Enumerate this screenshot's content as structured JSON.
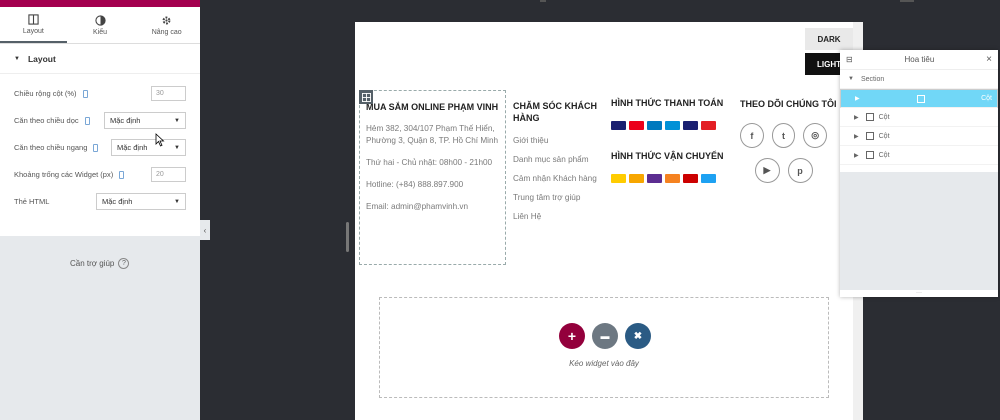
{
  "panel": {
    "tabs": [
      {
        "label": "Layout",
        "icon": "layout-icon"
      },
      {
        "label": "Kiểu",
        "icon": "style-icon"
      },
      {
        "label": "Nâng cao",
        "icon": "gear-icon"
      }
    ],
    "section_title": "Layout",
    "controls": {
      "column_width": {
        "label": "Chiều rộng cột (%)",
        "value": "30"
      },
      "vertical_align": {
        "label": "Căn theo chiều dọc",
        "value": "Mặc định"
      },
      "horizontal_align": {
        "label": "Căn theo chiều ngang",
        "value": "Mặc định"
      },
      "widget_spacing": {
        "label": "Khoảng trống các Widget (px)",
        "value": "20"
      },
      "html_tag": {
        "label": "Thẻ HTML",
        "value": "Mặc định"
      }
    },
    "help_label": "Cần trợ giúp",
    "accent_color": "#a4004f"
  },
  "canvas": {
    "mode_dark": "DARK",
    "mode_light": "LIGHT",
    "col1": {
      "title": "MUA SẮM ONLINE PHẠM VINH",
      "address": "Hẻm 382, 304/107 Phạm Thế Hiển, Phường 3, Quận 8, TP. Hồ Chí Minh",
      "hours": "Thứ hai - Chủ nhật: 08h00 - 21h00",
      "hotline": "Hotline: (+84) 888.897.900",
      "email": "Email: admin@phamvinh.vn"
    },
    "col2": {
      "title": "CHĂM SÓC KHÁCH HÀNG",
      "items": [
        "Giới thiệu",
        "Danh mục sản phẩm",
        "Cảm nhận Khách hàng",
        "Trung tâm trợ giúp",
        "Liên Hệ"
      ]
    },
    "col3": {
      "payment_title": "HÌNH THỨC THANH TOÁN",
      "shipping_title": "HÌNH THỨC VẬN CHUYỂN",
      "payment_colors": [
        "#1a1f71",
        "#eb001b",
        "#0079be",
        "#0091d7",
        "#1a1f71",
        "#e31e24"
      ],
      "shipping_colors": [
        "#ffcc00",
        "#f7a600",
        "#5c2d91",
        "#f58220",
        "#c00",
        "#1da1f2"
      ]
    },
    "col4": {
      "title": "THEO DÕI CHÚNG TÔI",
      "socials": [
        {
          "icon": "facebook-icon",
          "glyph": "f"
        },
        {
          "icon": "twitter-icon",
          "glyph": "t"
        },
        {
          "icon": "instagram-icon",
          "glyph": "◎"
        },
        {
          "icon": "youtube-icon",
          "glyph": "▶"
        },
        {
          "icon": "pinterest-icon",
          "glyph": "p"
        }
      ]
    },
    "dropzone": {
      "text": "Kéo widget vào đây",
      "buttons": [
        {
          "icon": "add-icon",
          "glyph": "+",
          "color": "#93003c"
        },
        {
          "icon": "folder-icon",
          "glyph": "▬",
          "color": "#6d7882"
        },
        {
          "icon": "template-icon",
          "glyph": "✖",
          "color": "#2b5b84"
        }
      ]
    }
  },
  "navigator": {
    "title": "Hoa tiêu",
    "section_label": "Section",
    "columns": [
      "Cột",
      "Cột",
      "Cột",
      "Cột"
    ],
    "footer": "···"
  }
}
